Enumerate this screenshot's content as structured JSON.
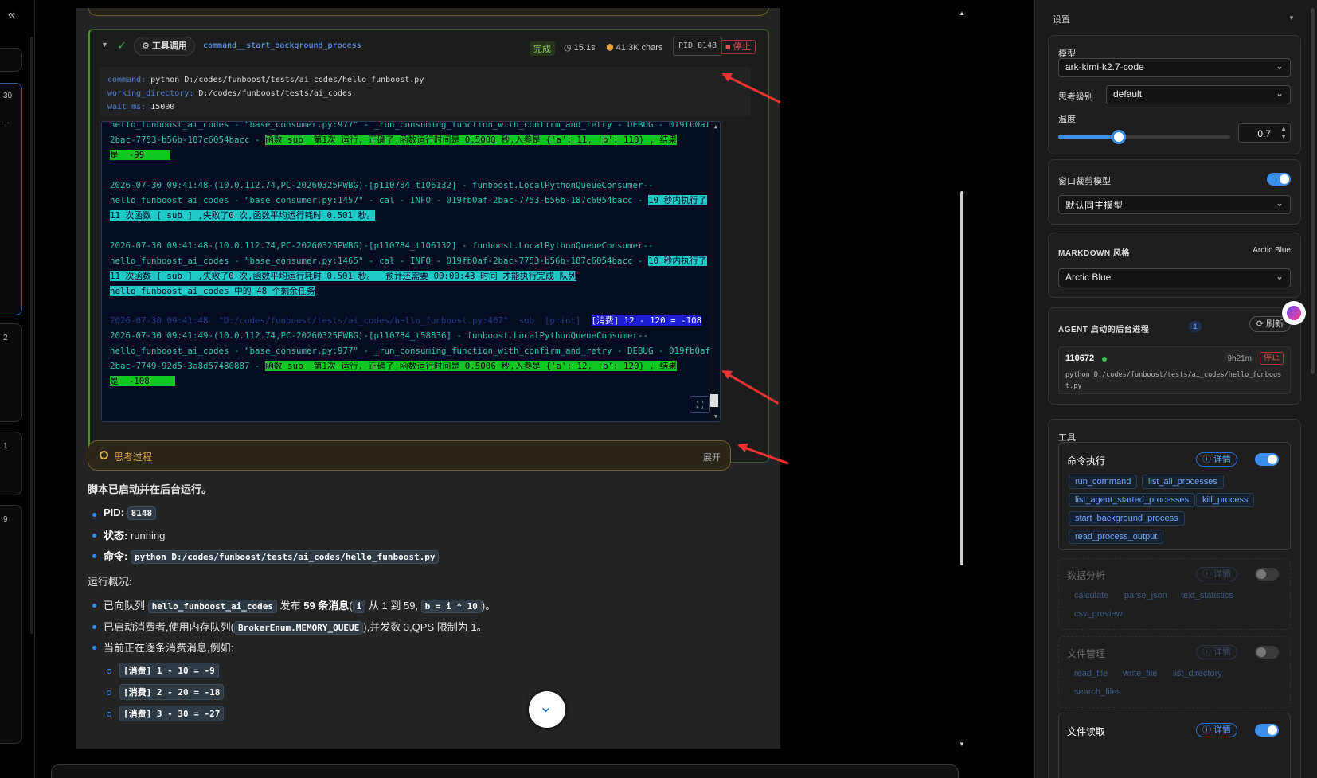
{
  "left_rail": {
    "collapse": "«",
    "numbers": [
      "30",
      "2",
      "1",
      "9"
    ]
  },
  "tool_card": {
    "label": "工具调用",
    "name": "command__start_background_process",
    "status": "完成",
    "time": "15.1s",
    "chars": "41.3K chars",
    "pid": "PID 8148",
    "stop": "停止",
    "params": [
      {
        "key": "command:",
        "value": "python D:/codes/funboost/tests/ai_codes/hello_funboost.py"
      },
      {
        "key": "working_directory:",
        "value": "D:/codes/funboost/tests/ai_codes"
      },
      {
        "key": "wait_ms:",
        "value": "15000"
      }
    ]
  },
  "terminal": {
    "lines": [
      {
        "pre": "hello_funboost_ai_codes - \"base_consumer.py:977\" - _run_consuming_function_with_confirm_and_retry - DEBUG - 019fb0af-",
        "hl": "",
        "post": ""
      },
      {
        "pre": "2bac-7753-b56b-187c6054bacc - ",
        "hl": "函数 sub  第1次 运行, 正确了,函数运行时间是 0.5008 秒,入参是 {'a': 11, 'b': 110} , 结果",
        "post": "",
        "kind": "green"
      },
      {
        "pre": "",
        "hl": "是  -99     ",
        "post": "",
        "kind": "green"
      },
      {
        "pre": "2026-07-30 09:41:48-(10.0.112.74,PC-20260325PWBG)-[p110784_t106132] - funboost.LocalPythonQueueConsumer--",
        "hl": "",
        "post": ""
      },
      {
        "pre": "hello_funboost_ai_codes - \"base_consumer.py:1457\" - cal - INFO - 019fb0af-2bac-7753-b56b-187c6054bacc - ",
        "hl": "10 秒内执行了",
        "post": "",
        "kind": "cyan"
      },
      {
        "pre": "",
        "hl": "11 次函数 [ sub ] ,失败了0 次,函数平均运行耗时 0.501 秒。",
        "post": "",
        "kind": "cyan"
      },
      {
        "pre": "2026-07-30 09:41:48-(10.0.112.74,PC-20260325PWBG)-[p110784_t106132] - funboost.LocalPythonQueueConsumer--",
        "hl": "",
        "post": ""
      },
      {
        "pre": "hello_funboost_ai_codes - \"base_consumer.py:1465\" - cal - INFO - 019fb0af-2bac-7753-b56b-187c6054bacc - ",
        "hl": "10 秒内执行了",
        "post": "",
        "kind": "cyan"
      },
      {
        "pre": "",
        "hl": "11 次函数 [ sub ] ,失败了0 次,函数平均运行耗时 0.501 秒。  预计还需要 00:00:43 时间 才能执行完成 队列",
        "post": "",
        "kind": "cyan"
      },
      {
        "pre": "",
        "hl": "hello_funboost_ai_codes 中的 48 个剩余任务",
        "post": "",
        "kind": "cyan"
      },
      {
        "pre": "",
        "dim": "2026-07-30 09:41:48  \"D:/codes/funboost/tests/ai_codes/hello_funboost.py:407\"  sub  [print]  ",
        "hl": "[消费] 12 - 120 = -108",
        "post": "",
        "kind": "blue"
      },
      {
        "pre": "2026-07-30 09:41:49-(10.0.112.74,PC-20260325PWBG)-[p110784_t58836] - funboost.LocalPythonQueueConsumer--",
        "hl": "",
        "post": ""
      },
      {
        "pre": "hello_funboost_ai_codes - \"base_consumer.py:977\" - _run_consuming_function_with_confirm_and_retry - DEBUG - 019fb0af-",
        "hl": "",
        "post": ""
      },
      {
        "pre": "2bac-7749-92d5-3a8d57480887 - ",
        "hl": "函数 sub  第1次 运行, 正确了,函数运行时间是 0.5006 秒,入参是 {'a': 12, 'b': 120} , 结果",
        "post": "",
        "kind": "green"
      },
      {
        "pre": "",
        "hl": "是  -108     ",
        "post": "",
        "kind": "green"
      }
    ],
    "expand_icon": "⛶"
  },
  "thinking": {
    "label": "思考过程",
    "expand": "展开"
  },
  "answer": {
    "intro": "脚本已启动并在后台运行。",
    "pid_label": "PID:",
    "pid_value": "8148",
    "status_label": "状态:",
    "status_value": "running",
    "cmd_label": "命令:",
    "cmd_value": "python D:/codes/funboost/tests/ai_codes/hello_funboost.py",
    "overview": "运行概况:",
    "b1_pre": "已向队列",
    "b1_code1": "hello_funboost_ai_codes",
    "b1_mid": "发布",
    "b1_bold": "59 条消息",
    "b1_paren_open": "(",
    "b1_code2": "i",
    "b1_mid2": "从 1 到 59,",
    "b1_code3": "b = i * 10",
    "b1_end": ")。",
    "b2_pre": "已启动消费者,使用内存队列(",
    "b2_code": "BrokerEnum.MEMORY_QUEUE",
    "b2_end": "),并发数 3,QPS 限制为 1。",
    "b3": "当前正在逐条消费消息,例如:",
    "sub": [
      "[消费] 1 - 10 = -9",
      "[消费] 2 - 20 = -18",
      "[消费] 3 - 30 = -27"
    ]
  },
  "settings": {
    "title": "设置",
    "model_label": "模型",
    "model_value": "ark-kimi-k2.7-code",
    "think_label": "思考级别",
    "think_value": "default",
    "temp_label": "温度",
    "temp_value": "0.7",
    "temp_fraction": 0.35,
    "clip_label": "窗口裁剪模型",
    "clip_value": "默认同主模型",
    "md_label": "MARKDOWN 风格",
    "md_current": "Arctic Blue",
    "md_value": "Arctic Blue",
    "agent_label": "AGENT 启动的后台进程",
    "agent_count": "1",
    "refresh": "刷新",
    "proc_pid": "110672",
    "proc_time": "9h21m",
    "proc_stop": "停止",
    "proc_cmd1": "python D:/codes/funboost/tests/ai_codes/hello_funboos",
    "proc_cmd2": "t.py",
    "tools_label": "工具",
    "detail": "ⓘ 详情",
    "groups": [
      {
        "name": "命令执行",
        "tags": [
          "run_command",
          "list_all_processes",
          "list_agent_started_processes",
          "kill_process",
          "start_background_process",
          "read_process_output"
        ]
      },
      {
        "name": "数据分析",
        "tags": [
          "calculate",
          "parse_json",
          "text_statistics",
          "csv_preview"
        ]
      },
      {
        "name": "文件管理",
        "tags": [
          "read_file",
          "write_file",
          "list_directory",
          "search_files"
        ]
      },
      {
        "name": "文件读取",
        "tags": []
      }
    ]
  }
}
